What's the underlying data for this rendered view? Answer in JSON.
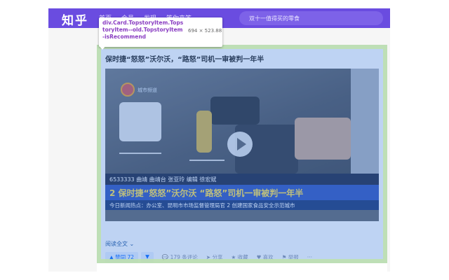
{
  "app": {
    "logo": "知乎",
    "nav": [
      "首页",
      "会员",
      "发现",
      "等你来答"
    ],
    "search_placeholder": "双十一值得买的零食"
  },
  "devtools": {
    "selector": "div.Card.TopstoryItem.TopstoryItem--old.TopstoryItem-isRecommend",
    "size": "694 × 523.88"
  },
  "card": {
    "title": "保时捷“怒怒”沃尔沃，“路怒”司机一审被判一年半",
    "video": {
      "channel": "城市频道",
      "credit": "6533333 曲靖 曲靖台 张亚玲 编辑 徐宏斌",
      "banner": "2 保时捷“怒怒”沃尔沃 “路怒”司机一审被判一年半",
      "ticker": "今日新闻热点：办公室、昆明市市场监督管理局官   2 创建国家食品安全示范城市"
    },
    "read_more": "阅读全文 ⌄",
    "actions": {
      "vote_up": "▲ 赞同 72",
      "vote_down": "▼",
      "comments": "💬 179 条评论",
      "share": "➤ 分享",
      "favorite": "★ 收藏",
      "like": "♥ 喜欢",
      "report": "⚑ 举报",
      "more": "···"
    }
  }
}
